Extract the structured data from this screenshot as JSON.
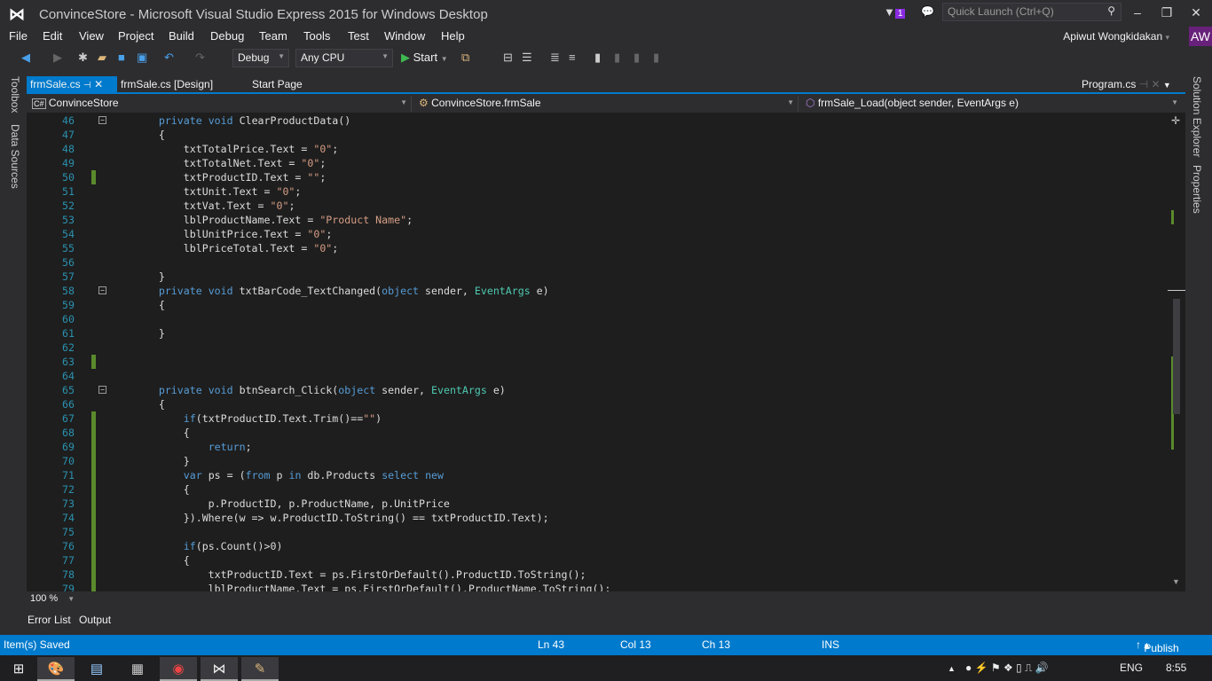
{
  "window": {
    "title": "ConvinceStore - Microsoft Visual Studio Express 2015 for Windows Desktop",
    "notification_count": "1",
    "quick_launch_placeholder": "Quick Launch (Ctrl+Q)",
    "user": "Apiwut Wongkidakan",
    "avatar": "AW"
  },
  "menu": [
    "File",
    "Edit",
    "View",
    "Project",
    "Build",
    "Debug",
    "Team",
    "Tools",
    "Test",
    "Window",
    "Help"
  ],
  "toolbar": {
    "config": "Debug",
    "platform": "Any CPU",
    "start": "Start"
  },
  "left_panels": [
    "Toolbox",
    "Data Sources"
  ],
  "right_panels": [
    "Solution Explorer",
    "Properties"
  ],
  "tabs": [
    {
      "label": "frmSale.cs",
      "active": true
    },
    {
      "label": "frmSale.cs [Design]"
    },
    {
      "label": "Start Page"
    }
  ],
  "preview_tab": "Program.cs",
  "navbar": {
    "project": "ConvinceStore",
    "class": "ConvinceStore.frmSale",
    "member": "frmSale_Load(object sender, EventArgs e)"
  },
  "colors": {
    "accent": "#007acc",
    "keyword": "#569cd6",
    "string": "#d69d85",
    "type": "#4ec9b0",
    "line_number": "#2b91af",
    "change_marker": "#5a8a2c"
  },
  "code": {
    "lines": [
      {
        "n": "46",
        "f": "⊟",
        "s": [
          [
            "        ",
            "tx"
          ],
          [
            "private",
            "kw"
          ],
          [
            " ",
            "tx"
          ],
          [
            "void",
            "kw"
          ],
          [
            " ClearProductData()",
            "tx"
          ]
        ]
      },
      {
        "n": "47",
        "s": [
          [
            "        {",
            "tx"
          ]
        ]
      },
      {
        "n": "48",
        "s": [
          [
            "            txtTotalPrice.Text = ",
            "tx"
          ],
          [
            "\"0\"",
            "str"
          ],
          [
            ";",
            "tx"
          ]
        ]
      },
      {
        "n": "49",
        "s": [
          [
            "            txtTotalNet.Text = ",
            "tx"
          ],
          [
            "\"0\"",
            "str"
          ],
          [
            ";",
            "tx"
          ]
        ]
      },
      {
        "n": "50",
        "c": true,
        "s": [
          [
            "            txtProductID.Text = ",
            "tx"
          ],
          [
            "\"\"",
            "str"
          ],
          [
            ";",
            "tx"
          ]
        ]
      },
      {
        "n": "51",
        "s": [
          [
            "            txtUnit.Text = ",
            "tx"
          ],
          [
            "\"0\"",
            "str"
          ],
          [
            ";",
            "tx"
          ]
        ]
      },
      {
        "n": "52",
        "s": [
          [
            "            txtVat.Text = ",
            "tx"
          ],
          [
            "\"0\"",
            "str"
          ],
          [
            ";",
            "tx"
          ]
        ]
      },
      {
        "n": "53",
        "s": [
          [
            "            lblProductName.Text = ",
            "tx"
          ],
          [
            "\"Product Name\"",
            "str"
          ],
          [
            ";",
            "tx"
          ]
        ]
      },
      {
        "n": "54",
        "s": [
          [
            "            lblUnitPrice.Text = ",
            "tx"
          ],
          [
            "\"0\"",
            "str"
          ],
          [
            ";",
            "tx"
          ]
        ]
      },
      {
        "n": "55",
        "s": [
          [
            "            lblPriceTotal.Text = ",
            "tx"
          ],
          [
            "\"0\"",
            "str"
          ],
          [
            ";",
            "tx"
          ]
        ]
      },
      {
        "n": "56",
        "s": []
      },
      {
        "n": "57",
        "s": [
          [
            "        }",
            "tx"
          ]
        ]
      },
      {
        "n": "58",
        "f": "⊟",
        "s": [
          [
            "        ",
            "tx"
          ],
          [
            "private",
            "kw"
          ],
          [
            " ",
            "tx"
          ],
          [
            "void",
            "kw"
          ],
          [
            " txtBarCode_TextChanged(",
            "tx"
          ],
          [
            "object",
            "kw"
          ],
          [
            " sender, ",
            "tx"
          ],
          [
            "EventArgs",
            "ty"
          ],
          [
            " e)",
            "tx"
          ]
        ]
      },
      {
        "n": "59",
        "s": [
          [
            "        {",
            "tx"
          ]
        ]
      },
      {
        "n": "60",
        "s": []
      },
      {
        "n": "61",
        "s": [
          [
            "        }",
            "tx"
          ]
        ]
      },
      {
        "n": "62",
        "s": []
      },
      {
        "n": "63",
        "c": true,
        "s": []
      },
      {
        "n": "64",
        "s": []
      },
      {
        "n": "65",
        "f": "⊟",
        "s": [
          [
            "        ",
            "tx"
          ],
          [
            "private",
            "kw"
          ],
          [
            " ",
            "tx"
          ],
          [
            "void",
            "kw"
          ],
          [
            " btnSearch_Click(",
            "tx"
          ],
          [
            "object",
            "kw"
          ],
          [
            " sender, ",
            "tx"
          ],
          [
            "EventArgs",
            "ty"
          ],
          [
            " e)",
            "tx"
          ]
        ]
      },
      {
        "n": "66",
        "s": [
          [
            "        {",
            "tx"
          ]
        ]
      },
      {
        "n": "67",
        "c": true,
        "s": [
          [
            "            ",
            "tx"
          ],
          [
            "if",
            "kw"
          ],
          [
            "(txtProductID.Text.Trim()==",
            "tx"
          ],
          [
            "\"\"",
            "str"
          ],
          [
            ")",
            "tx"
          ]
        ]
      },
      {
        "n": "68",
        "c": true,
        "s": [
          [
            "            {",
            "tx"
          ]
        ]
      },
      {
        "n": "69",
        "c": true,
        "s": [
          [
            "                ",
            "tx"
          ],
          [
            "return",
            "kw"
          ],
          [
            ";",
            "tx"
          ]
        ]
      },
      {
        "n": "70",
        "c": true,
        "s": [
          [
            "            }",
            "tx"
          ]
        ]
      },
      {
        "n": "71",
        "c": true,
        "s": [
          [
            "            ",
            "tx"
          ],
          [
            "var",
            "kw"
          ],
          [
            " ps = (",
            "tx"
          ],
          [
            "from",
            "kw"
          ],
          [
            " p ",
            "tx"
          ],
          [
            "in",
            "kw"
          ],
          [
            " db.Products ",
            "tx"
          ],
          [
            "select",
            "kw"
          ],
          [
            " ",
            "tx"
          ],
          [
            "new",
            "kw"
          ]
        ]
      },
      {
        "n": "72",
        "c": true,
        "s": [
          [
            "            {",
            "tx"
          ]
        ]
      },
      {
        "n": "73",
        "c": true,
        "s": [
          [
            "                p.ProductID, p.ProductName, p.UnitPrice",
            "tx"
          ]
        ]
      },
      {
        "n": "74",
        "c": true,
        "s": [
          [
            "            }).Where(w => w.ProductID.ToString() == txtProductID.Text);",
            "tx"
          ]
        ]
      },
      {
        "n": "75",
        "c": true,
        "s": []
      },
      {
        "n": "76",
        "c": true,
        "s": [
          [
            "            ",
            "tx"
          ],
          [
            "if",
            "kw"
          ],
          [
            "(ps.Count()>0)",
            "tx"
          ]
        ]
      },
      {
        "n": "77",
        "c": true,
        "s": [
          [
            "            {",
            "tx"
          ]
        ]
      },
      {
        "n": "78",
        "c": true,
        "s": [
          [
            "                txtProductID.Text = ps.FirstOrDefault().ProductID.ToString();",
            "tx"
          ]
        ]
      },
      {
        "n": "79",
        "c": true,
        "s": [
          [
            "                lblProductName.Text = ps.FirstOrDefault().ProductName.ToString();",
            "tx"
          ]
        ]
      }
    ]
  },
  "zoom": "100 %",
  "bottom_tabs": [
    "Error List",
    "Output"
  ],
  "status": {
    "message": "Item(s) Saved",
    "ln": "Ln 43",
    "col": "Col 13",
    "ch": "Ch 13",
    "mode": "INS",
    "publish": "Publish"
  },
  "taskbar": {
    "lang": "ENG",
    "time": "8:55"
  }
}
